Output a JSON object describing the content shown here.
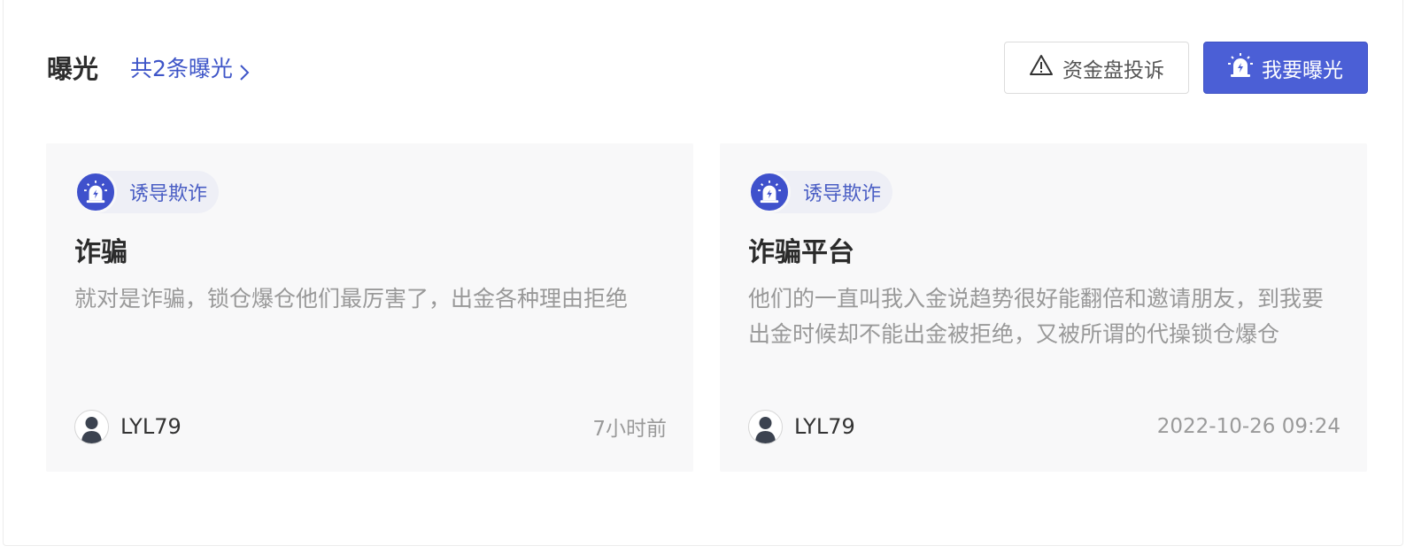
{
  "header": {
    "title": "曝光",
    "count_link": "共2条曝光",
    "complaint_button": "资金盘投诉",
    "expose_button": "我要曝光"
  },
  "colors": {
    "accent": "#4b5fd6",
    "link": "#3e55c8",
    "card_bg": "#f8f8f9"
  },
  "icons": {
    "warning": "warning-triangle-icon",
    "siren": "siren-alarm-icon",
    "chevron": "chevron-right-icon",
    "avatar": "default-user-avatar-icon"
  },
  "cards": [
    {
      "tag": "诱导欺诈",
      "title": "诈骗",
      "description": "就对是诈骗，锁仓爆仓他们最厉害了，出金各种理由拒绝",
      "user": "LYL79",
      "time": "7小时前"
    },
    {
      "tag": "诱导欺诈",
      "title": "诈骗平台",
      "description": "他们的一直叫我入金说趋势很好能翻倍和邀请朋友，到我要出金时候却不能出金被拒绝，又被所谓的代操锁仓爆仓",
      "user": "LYL79",
      "time": "2022-10-26 09:24"
    }
  ]
}
